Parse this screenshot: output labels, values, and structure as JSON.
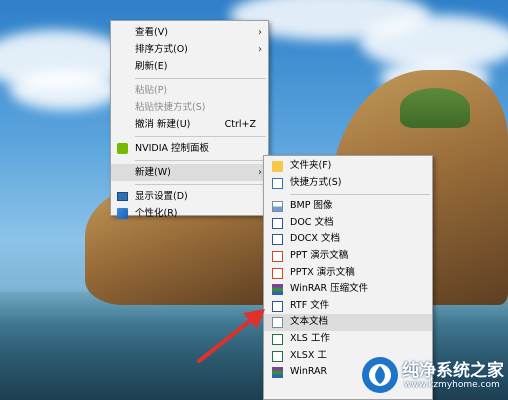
{
  "context_menu": {
    "items": [
      {
        "label": "查看(V)",
        "submenu": true
      },
      {
        "label": "排序方式(O)",
        "submenu": true
      },
      {
        "label": "刷新(E)"
      },
      {
        "label": "粘贴(P)",
        "disabled": true
      },
      {
        "label": "粘贴快捷方式(S)",
        "disabled": true
      },
      {
        "label": "撤消 新建(U)",
        "shortcut": "Ctrl+Z"
      },
      {
        "label": "NVIDIA 控制面板"
      },
      {
        "label": "新建(W)",
        "submenu": true
      },
      {
        "label": "显示设置(D)"
      },
      {
        "label": "个性化(R)"
      }
    ]
  },
  "new_submenu": {
    "items": [
      {
        "label": "文件夹(F)",
        "icon": "folder-icon"
      },
      {
        "label": "快捷方式(S)",
        "icon": "shortcut-icon"
      },
      {
        "label": "BMP 图像",
        "icon": "bmp-icon"
      },
      {
        "label": "DOC 文档",
        "icon": "doc-icon"
      },
      {
        "label": "DOCX 文档",
        "icon": "docx-icon"
      },
      {
        "label": "PPT 演示文稿",
        "icon": "ppt-icon"
      },
      {
        "label": "PPTX 演示文稿",
        "icon": "pptx-icon"
      },
      {
        "label": "WinRAR 压缩文件",
        "icon": "winrar-icon"
      },
      {
        "label": "RTF 文件",
        "icon": "rtf-icon"
      },
      {
        "label": "文本文档",
        "icon": "text-document-icon"
      },
      {
        "label": "XLS 工作",
        "icon": "xls-icon"
      },
      {
        "label": "XLSX 工",
        "icon": "xlsx-icon"
      },
      {
        "label": "WinRAR",
        "icon": "winrar-zip-icon"
      }
    ]
  },
  "watermark": {
    "title": "纯净系统之家",
    "url": "www.kzmyhome.com"
  },
  "colors": {
    "menu_bg": "#f2f2f2",
    "highlight": "#dcdcdc",
    "disabled_text": "#8d8d8d",
    "arrow": "#e0302a"
  }
}
